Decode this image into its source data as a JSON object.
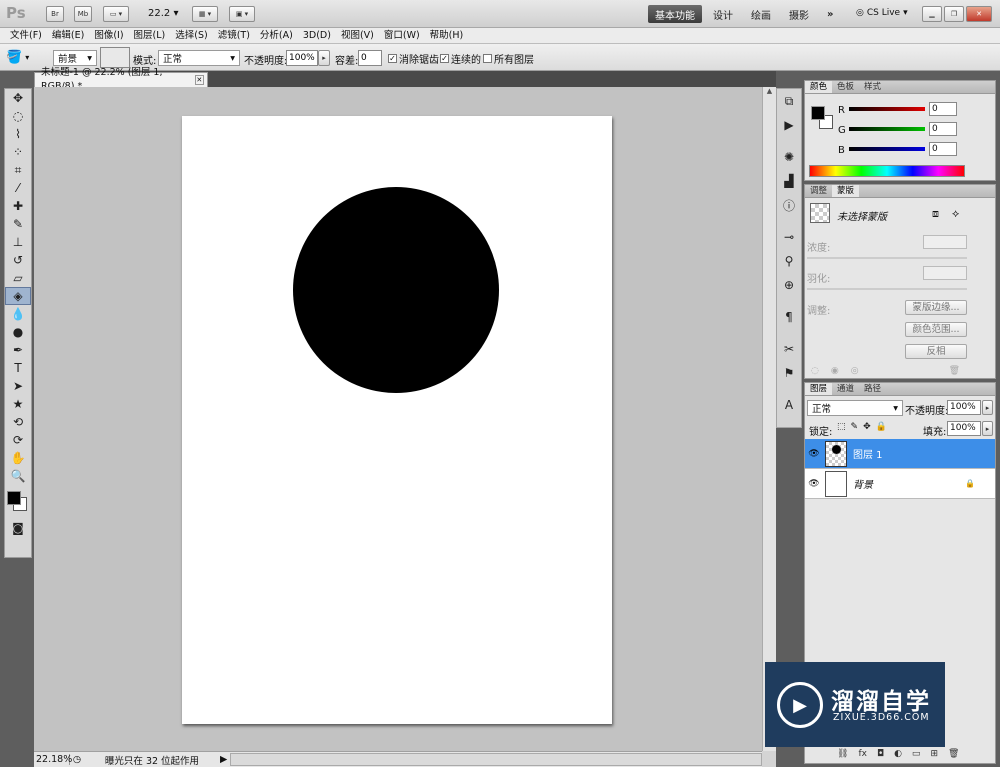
{
  "appbar": {
    "logo": "Ps",
    "br": "Br",
    "mb": "Mb",
    "zoom": "22.2",
    "workspaces": [
      "基本功能",
      "设计",
      "绘画",
      "摄影"
    ],
    "more": "»",
    "cslive": "CS Live"
  },
  "menu": [
    "文件(F)",
    "编辑(E)",
    "图像(I)",
    "图层(L)",
    "选择(S)",
    "滤镜(T)",
    "分析(A)",
    "3D(D)",
    "视图(V)",
    "窗口(W)",
    "帮助(H)"
  ],
  "options": {
    "fill": "前景",
    "mode_label": "模式:",
    "mode": "正常",
    "opacity_label": "不透明度:",
    "opacity": "100%",
    "tolerance_label": "容差:",
    "tolerance": "0",
    "antialias": "消除锯齿",
    "contiguous": "连续的",
    "all_layers": "所有图层"
  },
  "document": {
    "tab": "未标题-1 @ 22.2% (图层 1, RGB/8) *",
    "status_zoom": "22.18%",
    "status_text": "曝光只在 32 位起作用"
  },
  "color_panel": {
    "tabs": [
      "颜色",
      "色板",
      "样式"
    ],
    "r_label": "R",
    "r": "0",
    "g_label": "G",
    "g": "0",
    "b_label": "B",
    "b": "0"
  },
  "mask_panel": {
    "tabs": [
      "调整",
      "蒙版"
    ],
    "title": "未选择蒙版",
    "density": "浓度:",
    "feather": "羽化:",
    "refine": "调整:",
    "btn_edge": "蒙版边缘...",
    "btn_range": "颜色范围...",
    "btn_invert": "反相"
  },
  "layers_panel": {
    "tabs": [
      "图层",
      "通道",
      "路径"
    ],
    "blend": "正常",
    "opacity_label": "不透明度:",
    "opacity": "100%",
    "lock_label": "锁定:",
    "fill_label": "填充:",
    "fill": "100%",
    "layers": [
      {
        "name": "图层 1",
        "selected": true
      },
      {
        "name": "背景",
        "selected": false
      }
    ]
  },
  "watermark": {
    "title": "溜溜自学",
    "url": "ZIXUE.3D66.COM"
  }
}
